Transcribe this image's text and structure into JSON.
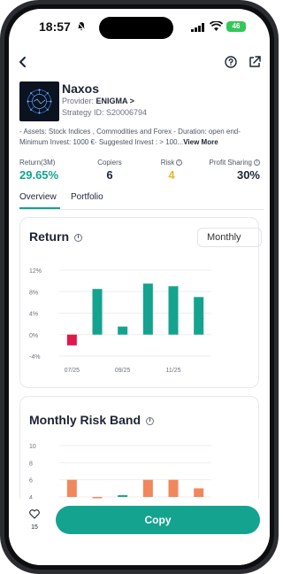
{
  "status_bar": {
    "time": "18:57",
    "battery": "46"
  },
  "strategy": {
    "name": "Naxos",
    "provider_prefix": "Provider: ",
    "provider_name": "ENIGMA >",
    "strategy_id": "Strategy ID: S20006794",
    "description": "- Assets: Stock Indices , Commodities and Forex - Duration: open end- Minimum Invest: 1000 €- Suggested Invest : > 100...",
    "view_more": "View More"
  },
  "stats": [
    {
      "label": "Return(3M)",
      "value": "29.65%",
      "color": "#14a38f"
    },
    {
      "label": "Copiers",
      "value": "6",
      "color": "#1c2433"
    },
    {
      "label": "Risk",
      "value": "4",
      "color": "#e8b923"
    },
    {
      "label": "Profit Sharing",
      "value": "30%",
      "color": "#1c2433"
    }
  ],
  "tabs": [
    {
      "label": "Overview",
      "active": true
    },
    {
      "label": "Portfolio",
      "active": false
    }
  ],
  "return_card": {
    "title": "Return",
    "period_select": "Monthly"
  },
  "risk_card": {
    "title": "Monthly Risk Band"
  },
  "footer": {
    "likes": "15",
    "copy_label": "Copy"
  },
  "colors": {
    "accent": "#14a38f",
    "negative": "#e0194a",
    "risk_bar": "#f2875c",
    "risk_value": "#e8b923"
  },
  "chart_data": [
    {
      "type": "bar",
      "title": "Return",
      "y_ticks": [
        "12%",
        "8%",
        "4%",
        "0%",
        "-4%"
      ],
      "x_ticks": [
        "07/25",
        "09/25",
        "11/25"
      ],
      "ylim": [
        -4,
        12
      ],
      "values": [
        -2,
        8.5,
        1.5,
        9.5,
        9,
        7
      ],
      "colors": [
        "#e0194a",
        "#14a38f",
        "#14a38f",
        "#14a38f",
        "#14a38f",
        "#14a38f"
      ]
    },
    {
      "type": "bar",
      "title": "Monthly Risk Band",
      "y_ticks": [
        "10",
        "8",
        "6",
        "4"
      ],
      "ylim": [
        4,
        10
      ],
      "values": [
        6,
        4,
        4.2,
        6,
        6,
        5
      ],
      "colors": [
        "#f2875c",
        "#f2875c",
        "#14a38f",
        "#f2875c",
        "#f2875c",
        "#f2875c"
      ]
    }
  ]
}
